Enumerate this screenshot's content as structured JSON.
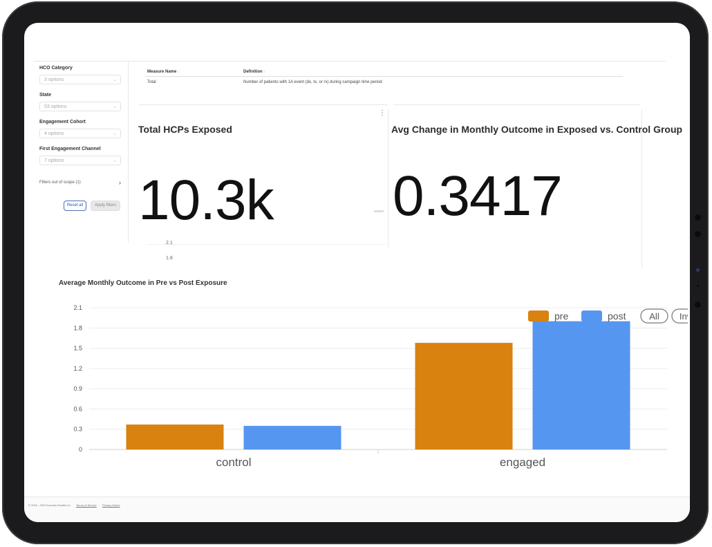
{
  "filters": {
    "items": [
      {
        "label": "HCO Category",
        "value": "3 options"
      },
      {
        "label": "State",
        "value": "53 options"
      },
      {
        "label": "Engagement Cohort",
        "value": "4 options"
      },
      {
        "label": "First Engagement Channel",
        "value": "7 options"
      }
    ],
    "out_of_scope": "Filters out of scope (1)",
    "reset_label": "Reset all",
    "apply_label": "Apply filters"
  },
  "measures": {
    "col_name": "Measure Name",
    "col_definition": "Definition",
    "row_name": "Total",
    "row_definition": "Number of patients with 1A event (dx, tx, or rx) during campaign time period"
  },
  "kpi_left": {
    "title": "Total HCPs Exposed",
    "value": "10.3k"
  },
  "kpi_right": {
    "title": "Avg Change in Monthly Outcome in Exposed vs. Control Group",
    "value": "0.3417"
  },
  "ghost_ticks": [
    "2.1",
    "1.8"
  ],
  "chart_data": {
    "type": "bar",
    "title": "Average Monthly Outcome in Pre vs Post Exposure",
    "categories": [
      "control",
      "engaged"
    ],
    "series": [
      {
        "name": "pre",
        "color": "#d9820f",
        "values": [
          0.37,
          1.58
        ]
      },
      {
        "name": "post",
        "color": "#5596f0",
        "values": [
          0.35,
          1.9
        ]
      }
    ],
    "yticks": [
      "0",
      "0.3",
      "0.6",
      "0.9",
      "1.2",
      "1.5",
      "1.8",
      "2.1"
    ],
    "ylim": [
      0,
      2.1
    ],
    "legend_position": "top-right",
    "legend_buttons": [
      "All",
      "Inv"
    ]
  },
  "footer": {
    "copyright": "© 2016 - 2023 Komodo Health Inc.",
    "terms": "Terms of Service",
    "privacy": "Privacy Notice"
  }
}
